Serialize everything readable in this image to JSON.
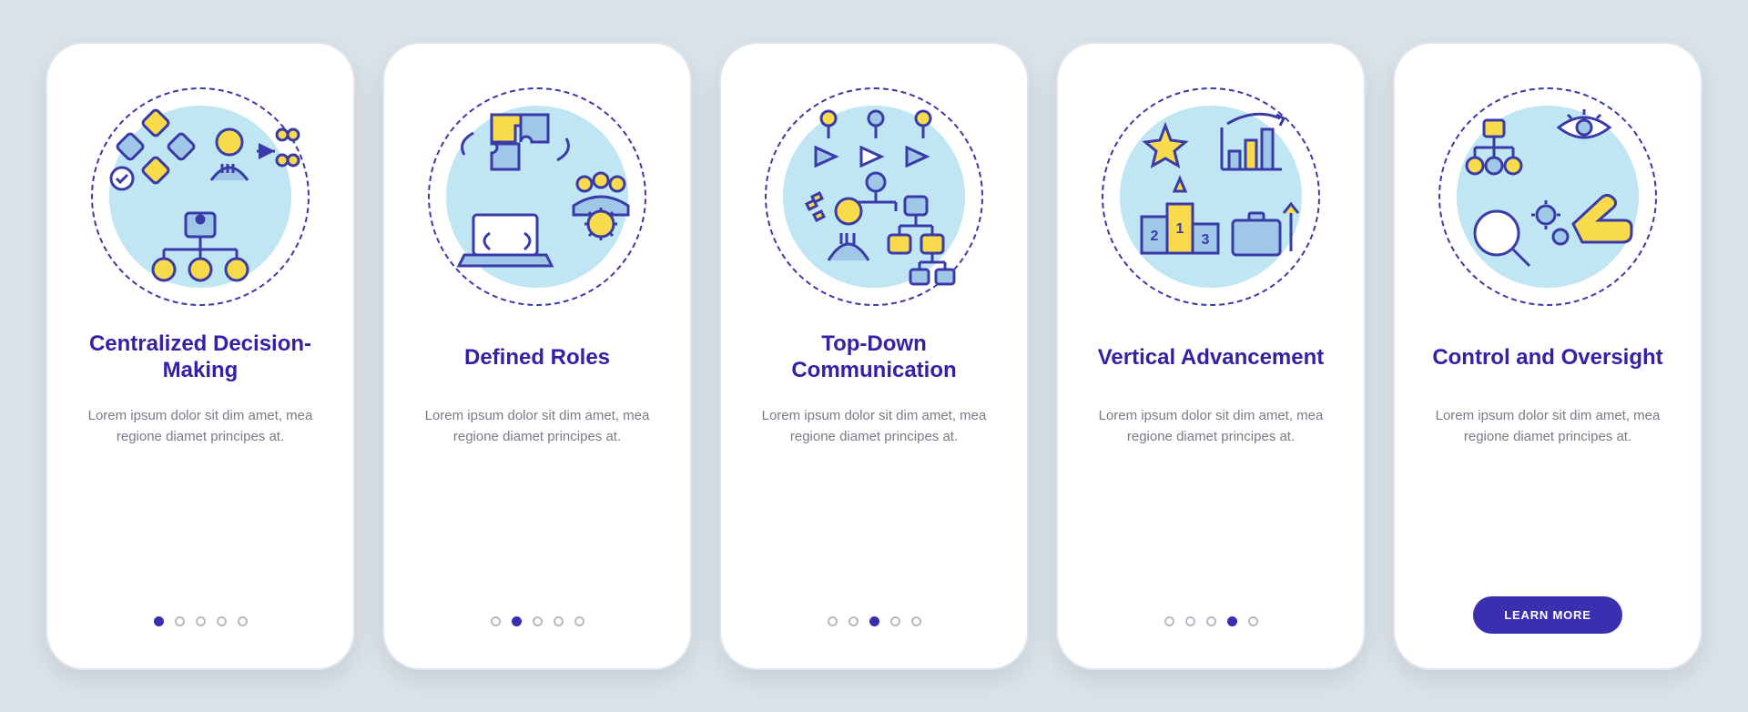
{
  "cards": [
    {
      "title": "Centralized Decision-Making",
      "desc": "Lorem ipsum dolor sit dim amet, mea regione diamet principes at.",
      "icon": "centralized-decision-icon"
    },
    {
      "title": "Defined Roles",
      "desc": "Lorem ipsum dolor sit dim amet, mea regione diamet principes at.",
      "icon": "defined-roles-icon"
    },
    {
      "title": "Top-Down Communication",
      "desc": "Lorem ipsum dolor sit dim amet, mea regione diamet principes at.",
      "icon": "top-down-communication-icon"
    },
    {
      "title": "Vertical Advancement",
      "desc": "Lorem ipsum dolor sit dim amet, mea regione diamet principes at.",
      "icon": "vertical-advancement-icon"
    },
    {
      "title": "Control and Oversight",
      "desc": "Lorem ipsum dolor sit dim amet, mea regione diamet principes at.",
      "icon": "control-oversight-icon"
    }
  ],
  "pagination_count": 5,
  "cta_label": "LEARN MORE",
  "colors": {
    "accent": "#3a2fb0",
    "bg_circle": "#bfe6f2",
    "yellow": "#f8db4a",
    "blue": "#9fc8e8",
    "stroke": "#3a3aa8"
  }
}
